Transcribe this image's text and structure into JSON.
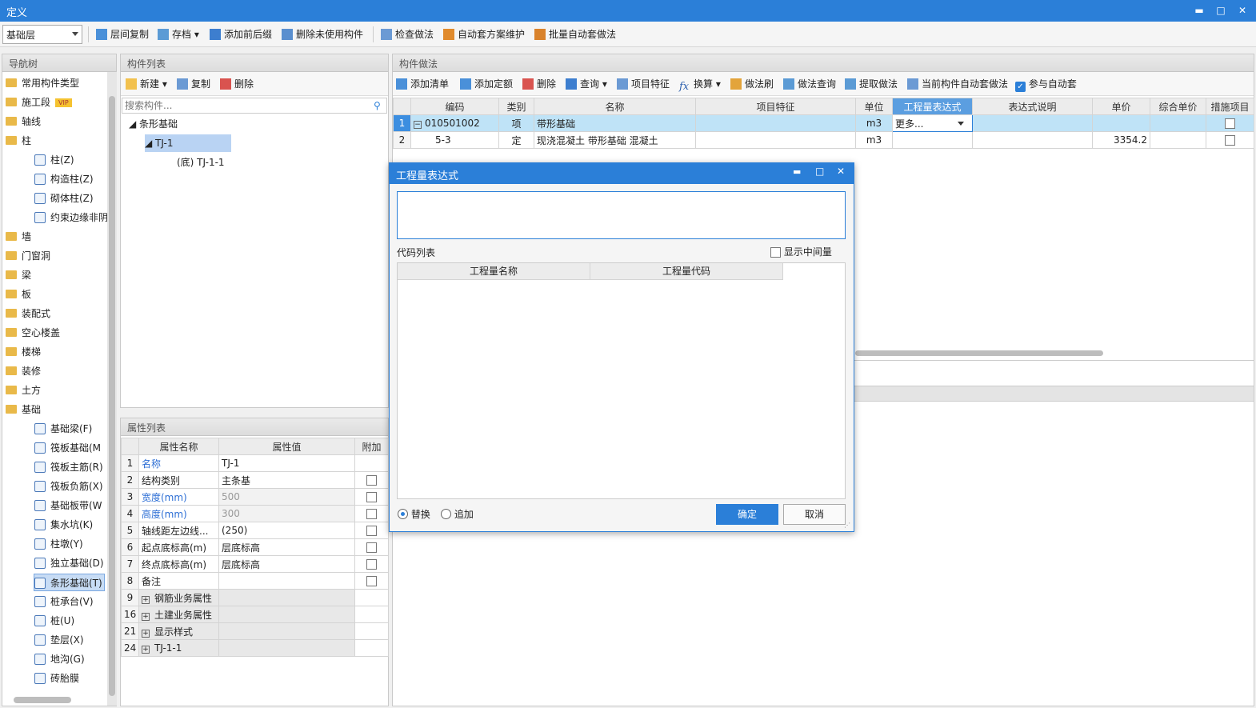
{
  "window": {
    "title": "定义",
    "min": "▬",
    "max": "□",
    "close": "✕"
  },
  "toolbar": {
    "floor": "基础层",
    "items": [
      "层间复制",
      "存档",
      "添加前后缀",
      "删除未使用构件",
      "检查做法",
      "自动套方案维护",
      "批量自动套做法"
    ]
  },
  "nav": {
    "title": "导航树",
    "items": [
      {
        "label": "常用构件类型",
        "type": "folder"
      },
      {
        "label": "施工段",
        "type": "folder",
        "badge": "VIP"
      },
      {
        "label": "轴线",
        "type": "folder"
      },
      {
        "label": "柱",
        "type": "folder-open"
      },
      {
        "label": "柱(Z)",
        "type": "sub"
      },
      {
        "label": "构造柱(Z)",
        "type": "sub"
      },
      {
        "label": "砌体柱(Z)",
        "type": "sub"
      },
      {
        "label": "约束边缘非阴",
        "type": "sub"
      },
      {
        "label": "墙",
        "type": "folder"
      },
      {
        "label": "门窗洞",
        "type": "folder"
      },
      {
        "label": "梁",
        "type": "folder"
      },
      {
        "label": "板",
        "type": "folder"
      },
      {
        "label": "装配式",
        "type": "folder"
      },
      {
        "label": "空心楼盖",
        "type": "folder"
      },
      {
        "label": "楼梯",
        "type": "folder"
      },
      {
        "label": "装修",
        "type": "folder"
      },
      {
        "label": "土方",
        "type": "folder"
      },
      {
        "label": "基础",
        "type": "folder-open"
      },
      {
        "label": "基础梁(F)",
        "type": "sub"
      },
      {
        "label": "筏板基础(M",
        "type": "sub"
      },
      {
        "label": "筏板主筋(R)",
        "type": "sub"
      },
      {
        "label": "筏板负筋(X)",
        "type": "sub"
      },
      {
        "label": "基础板带(W",
        "type": "sub"
      },
      {
        "label": "集水坑(K)",
        "type": "sub"
      },
      {
        "label": "柱墩(Y)",
        "type": "sub"
      },
      {
        "label": "独立基础(D)",
        "type": "sub"
      },
      {
        "label": "条形基础(T)",
        "type": "sub",
        "selected": true
      },
      {
        "label": "桩承台(V)",
        "type": "sub"
      },
      {
        "label": "桩(U)",
        "type": "sub"
      },
      {
        "label": "垫层(X)",
        "type": "sub"
      },
      {
        "label": "地沟(G)",
        "type": "sub"
      },
      {
        "label": "砖胎膜",
        "type": "sub"
      }
    ]
  },
  "complist": {
    "title": "构件列表",
    "new": "新建",
    "copy": "复制",
    "del": "删除",
    "search_placeholder": "搜索构件...",
    "tree": [
      "条形基础",
      "TJ-1",
      "(底) TJ-1-1"
    ]
  },
  "props": {
    "title": "属性列表",
    "headers": [
      "",
      "属性名称",
      "属性值",
      "附加"
    ],
    "rows": [
      {
        "n": "1",
        "name": "名称",
        "value": "TJ-1",
        "blue": true,
        "check": false,
        "gray": false
      },
      {
        "n": "2",
        "name": "结构类别",
        "value": "主条基",
        "blue": false,
        "check": true,
        "gray": false
      },
      {
        "n": "3",
        "name": "宽度(mm)",
        "value": "500",
        "blue": true,
        "check": true,
        "gray": true
      },
      {
        "n": "4",
        "name": "高度(mm)",
        "value": "300",
        "blue": true,
        "check": true,
        "gray": true
      },
      {
        "n": "5",
        "name": "轴线距左边线...",
        "value": "(250)",
        "blue": false,
        "check": true,
        "gray": false
      },
      {
        "n": "6",
        "name": "起点底标高(m)",
        "value": "层底标高",
        "blue": false,
        "check": true,
        "gray": false
      },
      {
        "n": "7",
        "name": "终点底标高(m)",
        "value": "层底标高",
        "blue": false,
        "check": true,
        "gray": false
      },
      {
        "n": "8",
        "name": "备注",
        "value": "",
        "blue": false,
        "check": true,
        "gray": false
      },
      {
        "n": "9",
        "name": "钢筋业务属性",
        "value": "",
        "group": true
      },
      {
        "n": "16",
        "name": "土建业务属性",
        "value": "",
        "group": true
      },
      {
        "n": "21",
        "name": "显示样式",
        "value": "",
        "group": true
      },
      {
        "n": "24",
        "name": "TJ-1-1",
        "value": "",
        "group": true
      }
    ]
  },
  "method": {
    "title": "构件做法",
    "tools": [
      "添加清单",
      "添加定额",
      "删除",
      "查询",
      "项目特征",
      "换算",
      "做法刷",
      "做法查询",
      "提取做法",
      "当前构件自动套做法",
      "参与自动套"
    ],
    "headers": [
      "",
      "编码",
      "类别",
      "名称",
      "项目特征",
      "单位",
      "工程量表达式",
      "表达式说明",
      "单价",
      "综合单价",
      "措施项目"
    ],
    "rows": [
      {
        "n": "1",
        "code": "010501002",
        "type": "项",
        "name": "带形基础",
        "feature": "",
        "unit": "m3",
        "expr": "更多...",
        "desc": "",
        "price": "",
        "total": ""
      },
      {
        "n": "2",
        "code": "5-3",
        "type": "定",
        "name": "现浇混凝土 带形基础 混凝土",
        "feature": "",
        "unit": "m3",
        "expr": "",
        "desc": "",
        "price": "3354.2",
        "total": ""
      }
    ]
  },
  "dialog": {
    "title": "工程量表达式",
    "code_list": "代码列表",
    "show_mid": "显示中间量",
    "col1": "工程量名称",
    "col2": "工程量代码",
    "replace": "替换",
    "append": "追加",
    "ok": "确定",
    "cancel": "取消"
  }
}
